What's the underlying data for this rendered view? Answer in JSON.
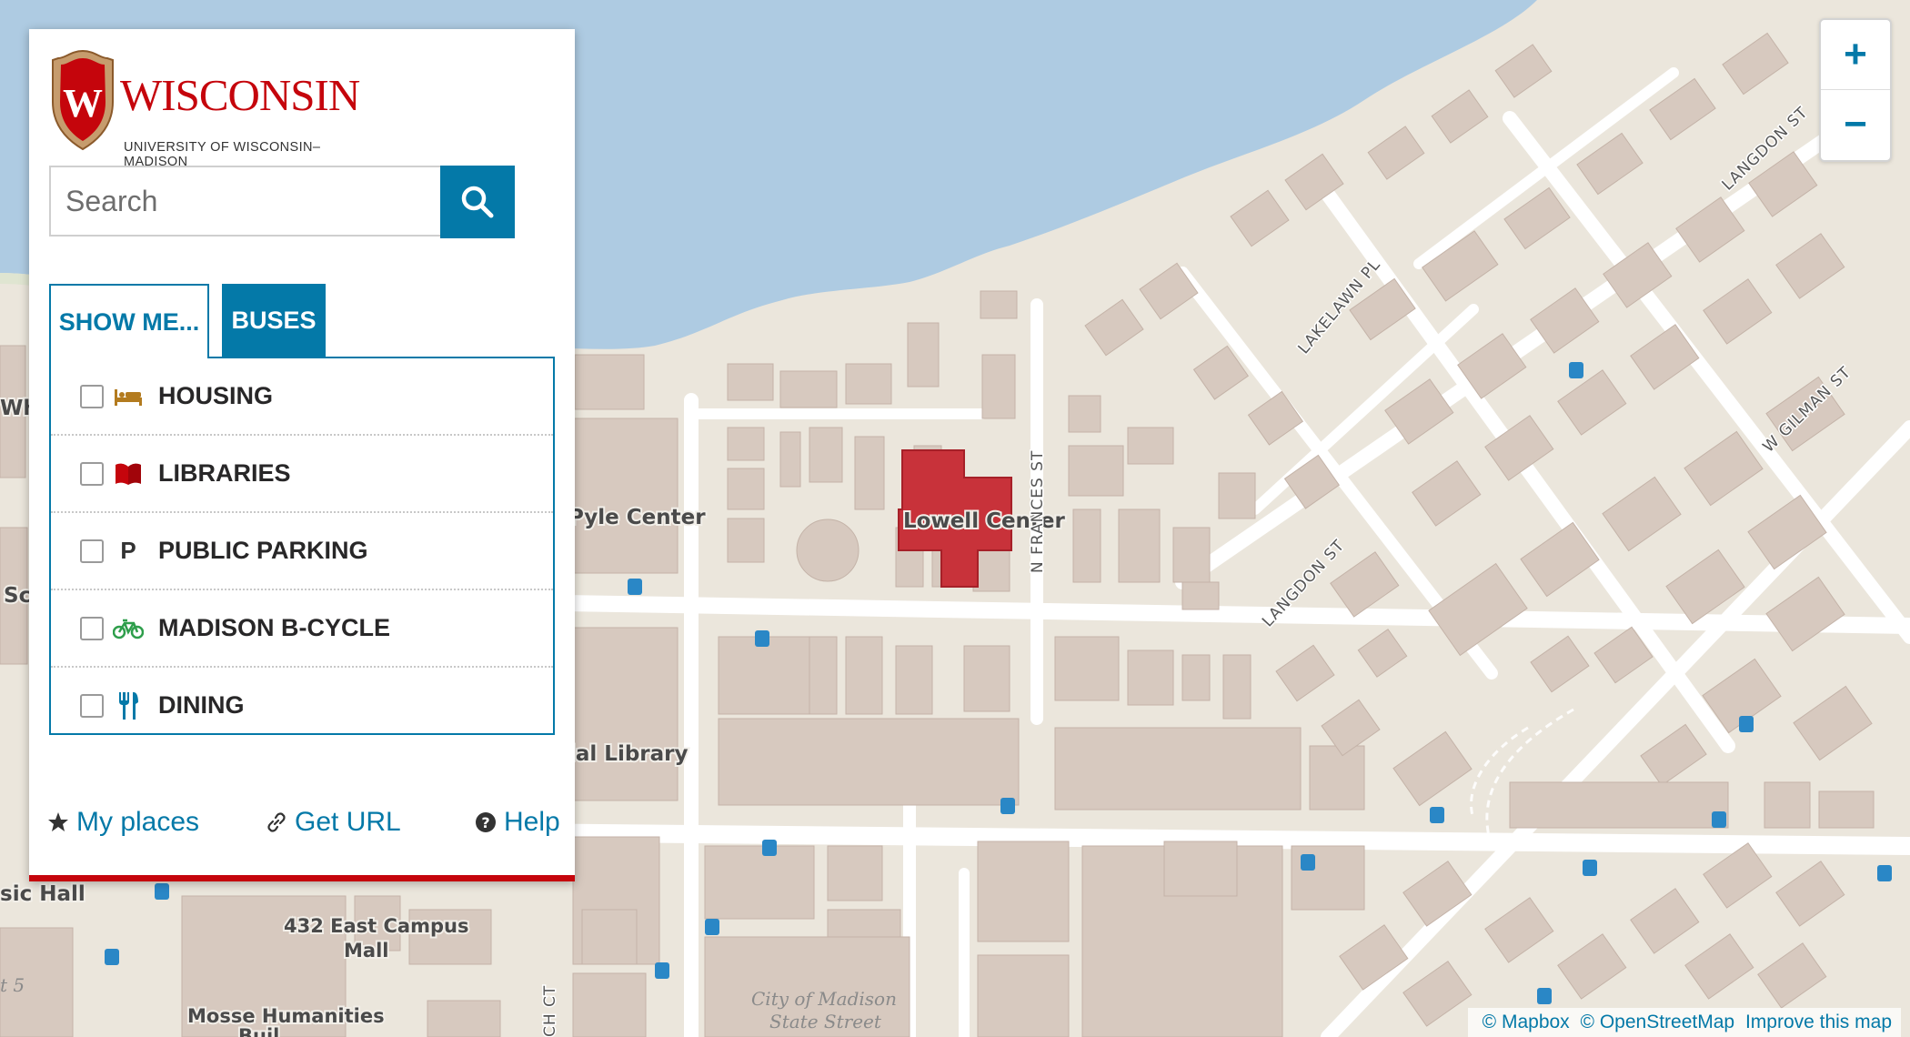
{
  "map": {
    "labels": {
      "pyle_center": "Pyle Center",
      "lowell_center": "Lowell Center",
      "memorial_library": "ial Library",
      "music_hall": "sic Hall",
      "east_campus_1": "432 East Campus",
      "east_campus_2": "Mall",
      "mosse": "Mosse Humanities",
      "mosse_2": "Buil",
      "left_whit": "Whit",
      "left_sc": "Sc",
      "left_t5": "t 5",
      "city_1": "City of Madison",
      "city_2": "State Street"
    },
    "streets": {
      "langdon_1": "LANGDON ST",
      "langdon_2": "LANGDON ST",
      "lakelawn": "LAKELAWN PL",
      "n_frances": "N FRANCES ST",
      "w_gilman": "W GILMAN ST",
      "ch_ct": "CH CT"
    },
    "colors": {
      "water": "#aecbe2",
      "land": "#ebe6dc",
      "building": "#d7c9bf",
      "highlight": "#c8323a",
      "road": "#ffffff"
    }
  },
  "zoom": {
    "in_label": "+",
    "out_label": "−"
  },
  "attribution": {
    "mapbox": "© Mapbox",
    "osm": "© OpenStreetMap",
    "improve": "Improve this map"
  },
  "panel": {
    "logo": {
      "wordmark": "WISCONSIN",
      "subtitle": "UNIVERSITY OF WISCONSIN–MADISON",
      "crest_letter": "W"
    },
    "search": {
      "placeholder": "Search",
      "value": ""
    },
    "tabs": [
      {
        "label": "SHOW ME...",
        "active": true
      },
      {
        "label": "BUSES",
        "active": false
      }
    ],
    "layers": [
      {
        "label": "HOUSING",
        "icon": "bed-icon",
        "checked": false
      },
      {
        "label": "LIBRARIES",
        "icon": "book-icon",
        "checked": false
      },
      {
        "label": "PUBLIC PARKING",
        "icon": "parking-icon",
        "icon_text": "P",
        "checked": false
      },
      {
        "label": "MADISON B-CYCLE",
        "icon": "bicycle-icon",
        "checked": false
      },
      {
        "label": "DINING",
        "icon": "utensils-icon",
        "checked": false
      }
    ],
    "footer": {
      "my_places": "My places",
      "get_url": "Get URL",
      "help": "Help"
    }
  }
}
